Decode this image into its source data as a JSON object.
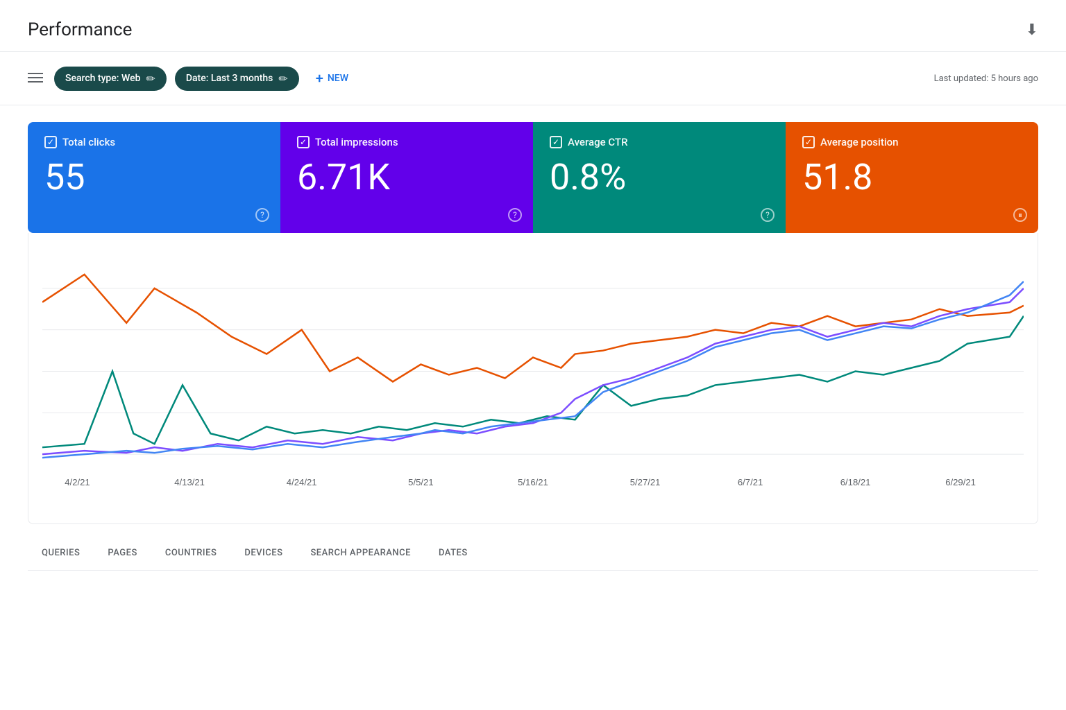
{
  "header": {
    "title": "Performance",
    "download_label": "⬇"
  },
  "toolbar": {
    "filter_icon": "≡",
    "search_type_chip": "Search type: Web",
    "date_chip": "Date: Last 3 months",
    "new_label": "NEW",
    "last_updated": "Last updated: 5 hours ago"
  },
  "metrics": [
    {
      "id": "total-clicks",
      "label": "Total clicks",
      "value": "55",
      "color": "blue",
      "checked": true
    },
    {
      "id": "total-impressions",
      "label": "Total impressions",
      "value": "6.71K",
      "color": "purple",
      "checked": true
    },
    {
      "id": "average-ctr",
      "label": "Average CTR",
      "value": "0.8%",
      "color": "teal",
      "checked": true
    },
    {
      "id": "average-position",
      "label": "Average position",
      "value": "51.8",
      "color": "orange",
      "checked": true
    }
  ],
  "chart": {
    "x_labels": [
      "4/2/21",
      "4/13/21",
      "4/24/21",
      "5/5/21",
      "5/16/21",
      "5/27/21",
      "6/7/21",
      "6/18/21",
      "6/29/21"
    ],
    "series": [
      {
        "name": "Total clicks",
        "color": "#1a73e8"
      },
      {
        "name": "Total impressions",
        "color": "#9c27b0"
      },
      {
        "name": "Average CTR",
        "color": "#00897b"
      },
      {
        "name": "Average position",
        "color": "#e65100"
      }
    ]
  },
  "bottom_tabs": [
    {
      "label": "QUERIES"
    },
    {
      "label": "PAGES"
    },
    {
      "label": "COUNTRIES"
    },
    {
      "label": "DEVICES"
    },
    {
      "label": "SEARCH APPEARANCE"
    },
    {
      "label": "DATES"
    }
  ]
}
